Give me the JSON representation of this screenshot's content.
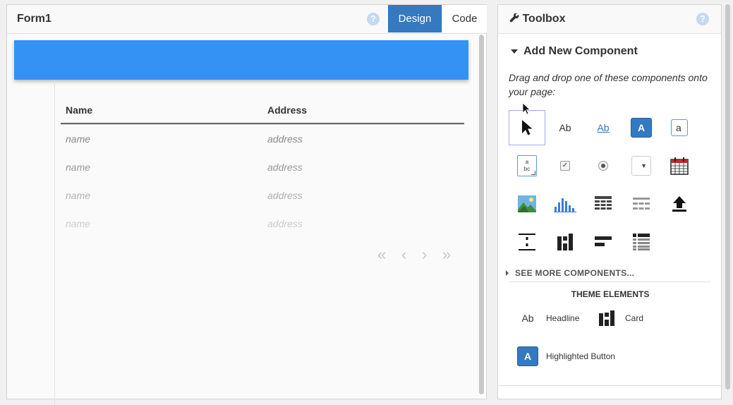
{
  "form": {
    "title": "Form1",
    "help": "?",
    "tabs": {
      "design": "Design",
      "code": "Code"
    }
  },
  "grid": {
    "columns": [
      "Name",
      "Address"
    ],
    "rows": [
      [
        "name",
        "address"
      ],
      [
        "name",
        "address"
      ],
      [
        "name",
        "address"
      ],
      [
        "name",
        "address"
      ]
    ],
    "pager": {
      "first": "«",
      "prev": "‹",
      "next": "›",
      "last": "»"
    }
  },
  "toolbox": {
    "title": "Toolbox",
    "help": "?",
    "section_title": "Add New Component",
    "instructions": "Drag and drop one of these components onto your page:",
    "components": {
      "label_text": "Ab",
      "link_text": "Ab",
      "button_text": "A",
      "textbox_text": "a",
      "textarea_line1": "a",
      "textarea_line2": "bc"
    },
    "see_more": "SEE MORE COMPONENTS...",
    "theme_title": "THEME ELEMENTS",
    "theme_items": {
      "headline_icon": "Ab",
      "headline": "Headline",
      "card": "Card",
      "button_icon": "A",
      "highlighted_button": "Highlighted Button"
    }
  },
  "colors": {
    "accent": "#3579c0",
    "banner": "#3592f5",
    "selection": "#a4a8f5"
  }
}
